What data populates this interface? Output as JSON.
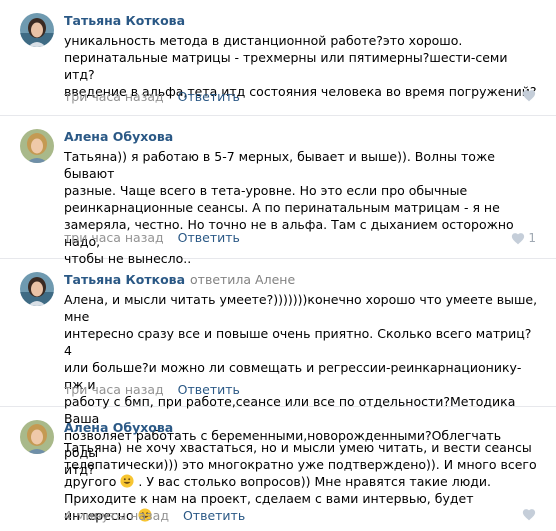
{
  "accent_color": "#2a5885",
  "comments": [
    {
      "author": "Татьяна Коткова",
      "reply_to": "",
      "lines": [
        "уникальность метода в дистанционной работе?это хорошо.",
        "перинатальные матрицы - трехмерны или пятимерны?шести-семи итд?",
        "введение в альфа,тета итд состояния человека во время погружений?"
      ],
      "time": "три часа назад",
      "reply_label": "Ответить",
      "likes": ""
    },
    {
      "author": "Алена Обухова",
      "reply_to": "",
      "lines": [
        "Татьяна)) я работаю в 5-7 мерных, бывает и выше)). Волны тоже бывают",
        "разные. Чаще всего в тета-уровне. Но это если про обычные",
        "реинкарнационные сеансы. А по перинатальным матрицам - я не",
        "замеряла, честно. Но точно не в альфа. Там с дыханием осторожно надо,",
        "чтобы не вынесло.."
      ],
      "time": "три часа назад",
      "reply_label": "Ответить",
      "likes": "1"
    },
    {
      "author": "Татьяна Коткова",
      "reply_to": "ответила Алене",
      "lines": [
        "Алена, и мысли читать умеете?)))))))конечно хорошо что умеете выше, мне",
        "интересно сразу все и повыше очень приятно. Сколько всего матриц? 4",
        "или больше?и можно ли совмещать и регрессии-реинкарнационику-пж и",
        "работу с бмп, при работе,сеансе или все по отдельности?Методика Ваша",
        "позволяет работать с беременными,новорожденными?Облегчать роды",
        "итд?"
      ],
      "time": "три часа назад",
      "reply_label": "Ответить",
      "likes": ""
    },
    {
      "author": "Алена Обухова",
      "reply_to": "",
      "lines_a": [
        "Татьяна) не хочу хвастаться, но и мысли умею читать, и вести сеансы",
        "телепатически))) это многократно уже подтверждено)). И много всего"
      ],
      "line_c_before": "другого",
      "line_c_after": ". У вас столько вопросов)) Мне нравятся такие люди.",
      "line_d": "Приходите к нам на проект, сделаем с вами интервью, будет интересно",
      "time": "4 минуты назад",
      "reply_label": "Ответить",
      "likes": ""
    }
  ]
}
